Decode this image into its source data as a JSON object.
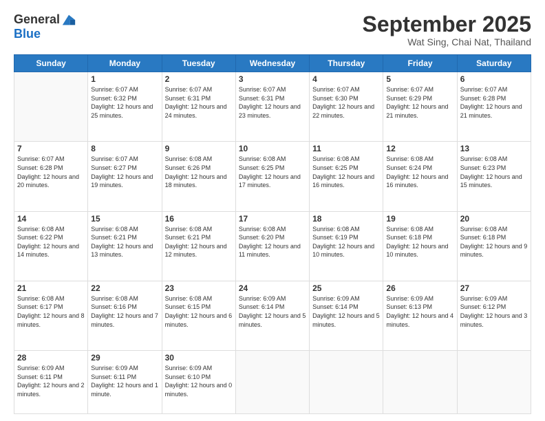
{
  "header": {
    "logo_general": "General",
    "logo_blue": "Blue",
    "month_title": "September 2025",
    "subtitle": "Wat Sing, Chai Nat, Thailand"
  },
  "days_of_week": [
    "Sunday",
    "Monday",
    "Tuesday",
    "Wednesday",
    "Thursday",
    "Friday",
    "Saturday"
  ],
  "weeks": [
    [
      {
        "day": "",
        "sunrise": "",
        "sunset": "",
        "daylight": ""
      },
      {
        "day": "1",
        "sunrise": "6:07 AM",
        "sunset": "6:32 PM",
        "daylight": "12 hours and 25 minutes."
      },
      {
        "day": "2",
        "sunrise": "6:07 AM",
        "sunset": "6:31 PM",
        "daylight": "12 hours and 24 minutes."
      },
      {
        "day": "3",
        "sunrise": "6:07 AM",
        "sunset": "6:31 PM",
        "daylight": "12 hours and 23 minutes."
      },
      {
        "day": "4",
        "sunrise": "6:07 AM",
        "sunset": "6:30 PM",
        "daylight": "12 hours and 22 minutes."
      },
      {
        "day": "5",
        "sunrise": "6:07 AM",
        "sunset": "6:29 PM",
        "daylight": "12 hours and 21 minutes."
      },
      {
        "day": "6",
        "sunrise": "6:07 AM",
        "sunset": "6:28 PM",
        "daylight": "12 hours and 21 minutes."
      }
    ],
    [
      {
        "day": "7",
        "sunrise": "6:07 AM",
        "sunset": "6:28 PM",
        "daylight": "12 hours and 20 minutes."
      },
      {
        "day": "8",
        "sunrise": "6:07 AM",
        "sunset": "6:27 PM",
        "daylight": "12 hours and 19 minutes."
      },
      {
        "day": "9",
        "sunrise": "6:08 AM",
        "sunset": "6:26 PM",
        "daylight": "12 hours and 18 minutes."
      },
      {
        "day": "10",
        "sunrise": "6:08 AM",
        "sunset": "6:25 PM",
        "daylight": "12 hours and 17 minutes."
      },
      {
        "day": "11",
        "sunrise": "6:08 AM",
        "sunset": "6:25 PM",
        "daylight": "12 hours and 16 minutes."
      },
      {
        "day": "12",
        "sunrise": "6:08 AM",
        "sunset": "6:24 PM",
        "daylight": "12 hours and 16 minutes."
      },
      {
        "day": "13",
        "sunrise": "6:08 AM",
        "sunset": "6:23 PM",
        "daylight": "12 hours and 15 minutes."
      }
    ],
    [
      {
        "day": "14",
        "sunrise": "6:08 AM",
        "sunset": "6:22 PM",
        "daylight": "12 hours and 14 minutes."
      },
      {
        "day": "15",
        "sunrise": "6:08 AM",
        "sunset": "6:21 PM",
        "daylight": "12 hours and 13 minutes."
      },
      {
        "day": "16",
        "sunrise": "6:08 AM",
        "sunset": "6:21 PM",
        "daylight": "12 hours and 12 minutes."
      },
      {
        "day": "17",
        "sunrise": "6:08 AM",
        "sunset": "6:20 PM",
        "daylight": "12 hours and 11 minutes."
      },
      {
        "day": "18",
        "sunrise": "6:08 AM",
        "sunset": "6:19 PM",
        "daylight": "12 hours and 10 minutes."
      },
      {
        "day": "19",
        "sunrise": "6:08 AM",
        "sunset": "6:18 PM",
        "daylight": "12 hours and 10 minutes."
      },
      {
        "day": "20",
        "sunrise": "6:08 AM",
        "sunset": "6:18 PM",
        "daylight": "12 hours and 9 minutes."
      }
    ],
    [
      {
        "day": "21",
        "sunrise": "6:08 AM",
        "sunset": "6:17 PM",
        "daylight": "12 hours and 8 minutes."
      },
      {
        "day": "22",
        "sunrise": "6:08 AM",
        "sunset": "6:16 PM",
        "daylight": "12 hours and 7 minutes."
      },
      {
        "day": "23",
        "sunrise": "6:08 AM",
        "sunset": "6:15 PM",
        "daylight": "12 hours and 6 minutes."
      },
      {
        "day": "24",
        "sunrise": "6:09 AM",
        "sunset": "6:14 PM",
        "daylight": "12 hours and 5 minutes."
      },
      {
        "day": "25",
        "sunrise": "6:09 AM",
        "sunset": "6:14 PM",
        "daylight": "12 hours and 5 minutes."
      },
      {
        "day": "26",
        "sunrise": "6:09 AM",
        "sunset": "6:13 PM",
        "daylight": "12 hours and 4 minutes."
      },
      {
        "day": "27",
        "sunrise": "6:09 AM",
        "sunset": "6:12 PM",
        "daylight": "12 hours and 3 minutes."
      }
    ],
    [
      {
        "day": "28",
        "sunrise": "6:09 AM",
        "sunset": "6:11 PM",
        "daylight": "12 hours and 2 minutes."
      },
      {
        "day": "29",
        "sunrise": "6:09 AM",
        "sunset": "6:11 PM",
        "daylight": "12 hours and 1 minute."
      },
      {
        "day": "30",
        "sunrise": "6:09 AM",
        "sunset": "6:10 PM",
        "daylight": "12 hours and 0 minutes."
      },
      {
        "day": "",
        "sunrise": "",
        "sunset": "",
        "daylight": ""
      },
      {
        "day": "",
        "sunrise": "",
        "sunset": "",
        "daylight": ""
      },
      {
        "day": "",
        "sunrise": "",
        "sunset": "",
        "daylight": ""
      },
      {
        "day": "",
        "sunrise": "",
        "sunset": "",
        "daylight": ""
      }
    ]
  ]
}
